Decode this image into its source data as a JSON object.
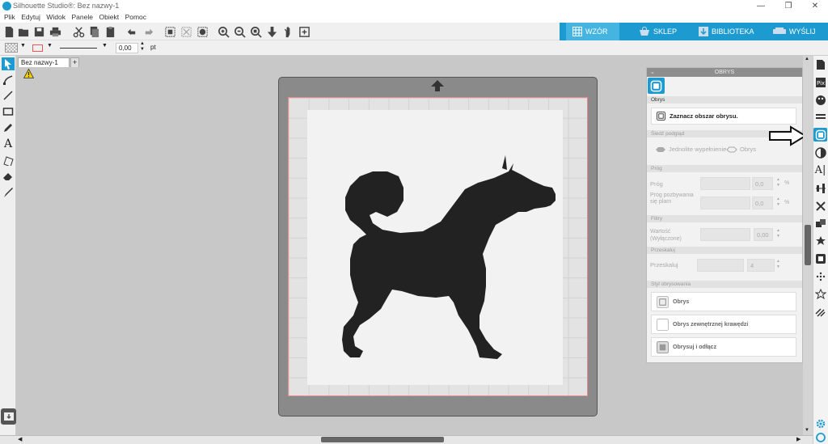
{
  "window": {
    "title": "Silhouette Studio®: Bez nazwy-1",
    "minimize": "—",
    "maximize": "❐",
    "close": "✕"
  },
  "menu": [
    "Plik",
    "Edytuj",
    "Widok",
    "Panele",
    "Obiekt",
    "Pomoc"
  ],
  "nav_tabs": [
    {
      "label": "WZÓR",
      "icon": "grid-icon",
      "active": true
    },
    {
      "label": "SKLEP",
      "icon": "store-icon",
      "active": false
    },
    {
      "label": "BIBLIOTEKA",
      "icon": "download-icon",
      "active": false
    },
    {
      "label": "WYŚLIJ",
      "icon": "cutter-icon",
      "active": false
    }
  ],
  "propbar": {
    "stroke_width": "0,00",
    "unit": "pt"
  },
  "document": {
    "tab_label": "Bez nazwy-1",
    "add_tab": "+"
  },
  "trace_panel": {
    "header": "OBRYS",
    "section_obrys": "Obrys",
    "select_area_button": "Zaznacz obszar obrysu.",
    "section_preview": "Śledź podgląd",
    "solid_fill": "Jednolite wypełnienie",
    "outline": "Obrys",
    "section_threshold": "Próg",
    "threshold_label": "Próg",
    "threshold_value": "0,0",
    "threshold_unit": "%",
    "removal_label": "Próg pozbywania się plam",
    "removal_value": "0,0",
    "removal_unit": "%",
    "section_filters": "Filtry",
    "filter_label": "Wartość (Wyłączone)",
    "filter_value": "0,00",
    "section_scale": "Przeskaluj",
    "scale_label": "Przeskaluj",
    "scale_value": "4",
    "section_style": "Styl obrysowania",
    "btn_trace": "Obrys",
    "btn_outer": "Obrys zewnętrznej krawędzi",
    "btn_detach": "Obrysuj i odłącz"
  },
  "colors": {
    "accent": "#1d9bd1",
    "panel_header": "#8e8e8e",
    "mat_border": "#e88a8a"
  }
}
